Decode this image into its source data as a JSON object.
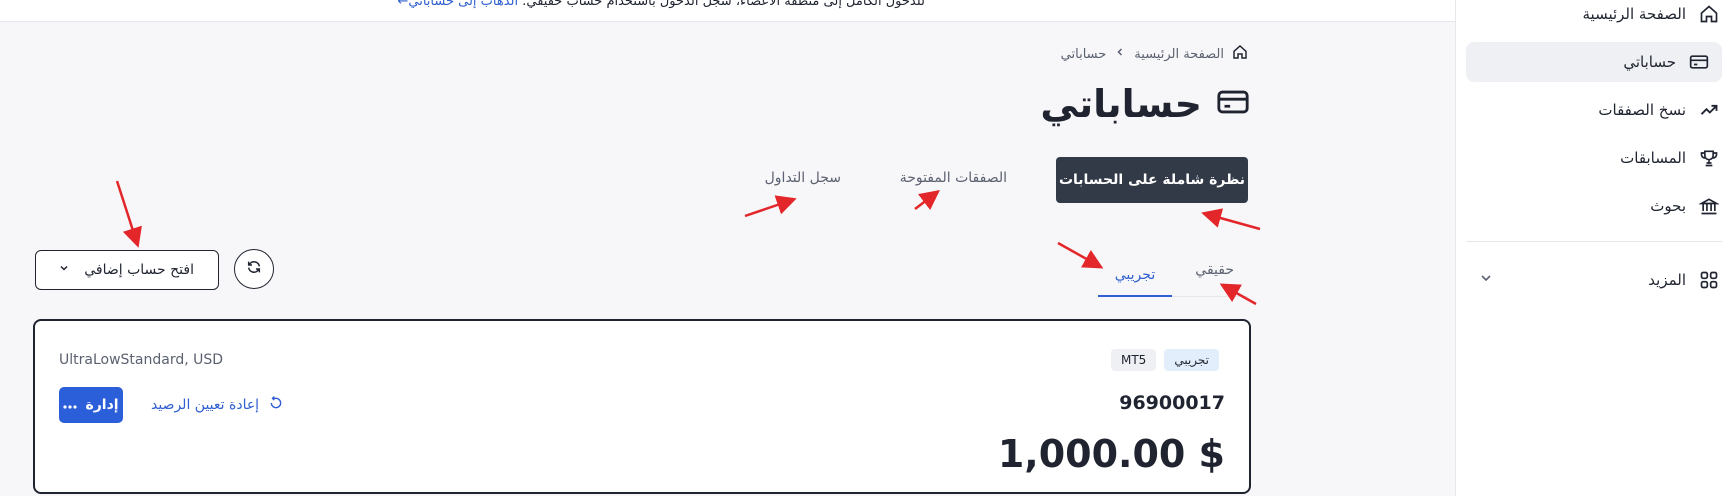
{
  "banner": {
    "text": "للدخول الكامل إلى منطقة الأعضاء، سجّل الدخول باستخدام حساب حقيقي.",
    "link": "الذهاب إلى حساباتي"
  },
  "sidebar": {
    "items": [
      {
        "label": "الصفحة الرئيسية",
        "icon": "home-icon"
      },
      {
        "label": "حساباتي",
        "icon": "card-icon",
        "active": true
      },
      {
        "label": "نسخ الصفقات",
        "icon": "trend-up-icon"
      },
      {
        "label": "المسابقات",
        "icon": "trophy-icon"
      },
      {
        "label": "بحوث",
        "icon": "bank-icon"
      }
    ],
    "more_label": "المزيد"
  },
  "breadcrumb": {
    "home": "الصفحة الرئيسية",
    "current": "حساباتي"
  },
  "page": {
    "title": "حساباتي"
  },
  "tabs": {
    "overview": "نظرة شاملة على الحسابات",
    "open_trades": "الصفقات المفتوحة",
    "history": "سجل التداول"
  },
  "subtabs": {
    "real": "حقيقي",
    "demo": "تجريبي",
    "active": "demo"
  },
  "controls": {
    "open_account": "افتح حساب إضافي"
  },
  "account": {
    "type": "UltraLowStandard, USD",
    "badge_demo": "تجريبي",
    "badge_platform": "MT5",
    "number": "96900017",
    "balance": "1,000.00 $",
    "reset_label": "إعادة تعيين الرصيد",
    "manage_label": "إدارة"
  },
  "colors": {
    "accent": "#2f5fd0",
    "dark_tab": "#323a48",
    "annotation": "#e3262a"
  }
}
